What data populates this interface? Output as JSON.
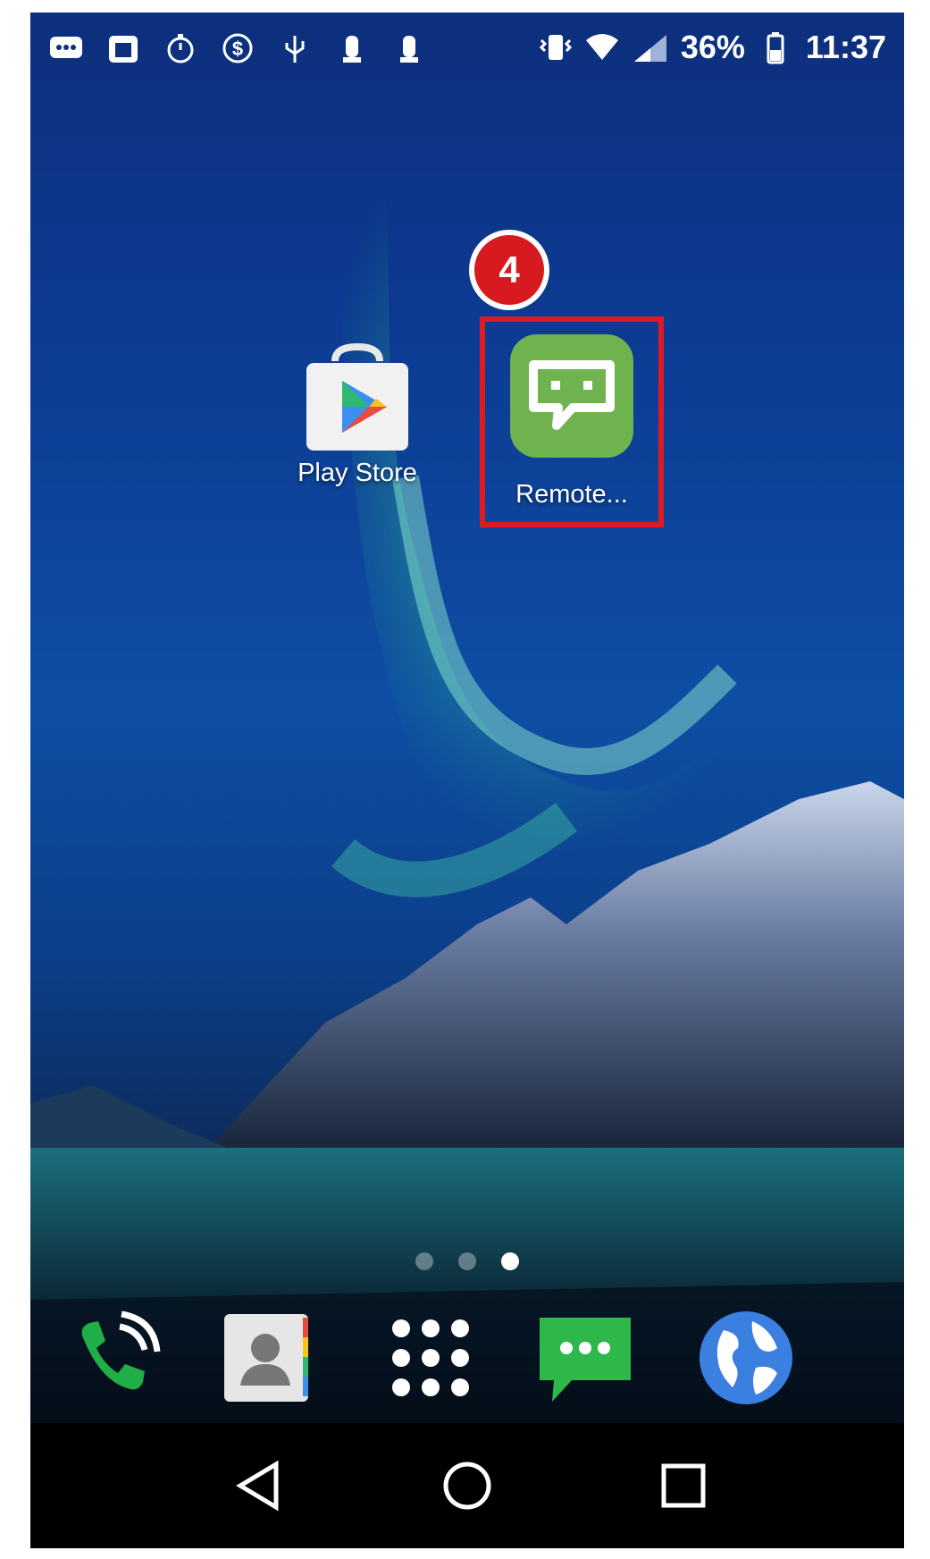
{
  "status_bar": {
    "left_icons": [
      "message-icon",
      "calendar-icon",
      "stopwatch-icon",
      "dollar-icon",
      "usb-icon",
      "pawn-icon",
      "pawn-icon"
    ],
    "battery_percent": "36%",
    "time": "11:37",
    "right_icons": [
      "vibrate-icon",
      "wifi-icon",
      "signal-icon",
      "battery-icon"
    ]
  },
  "apps": [
    {
      "label": "Play Store",
      "icon": "play-store-icon"
    },
    {
      "label": "Remote...",
      "icon": "remote-chat-icon"
    }
  ],
  "annotation": {
    "step_number": "4",
    "color": "#d71920"
  },
  "page_indicator": {
    "count": 3,
    "active": 3
  },
  "dock": [
    {
      "icon": "phone-icon"
    },
    {
      "icon": "contacts-icon"
    },
    {
      "icon": "app-drawer-icon"
    },
    {
      "icon": "messages-icon"
    },
    {
      "icon": "browser-globe-icon"
    }
  ],
  "nav_bar": [
    "back-icon",
    "home-icon",
    "recents-icon"
  ]
}
